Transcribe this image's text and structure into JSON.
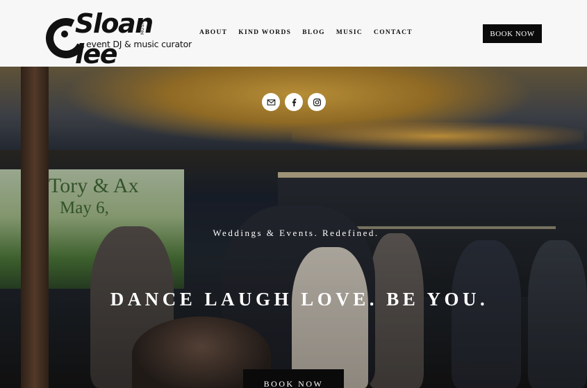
{
  "logo": {
    "name": "Sloan lee",
    "music": "MUSIC",
    "tagline": "event DJ & music curator"
  },
  "nav": {
    "items": [
      "ABOUT",
      "KIND WORDS",
      "BLOG",
      "MUSIC",
      "CONTACT"
    ]
  },
  "header": {
    "book_label": "BOOK NOW"
  },
  "hero": {
    "screen_text_line1": "Tory & Ax",
    "screen_text_line2": "May 6,",
    "socials": [
      "mail-icon",
      "facebook-icon",
      "instagram-icon"
    ],
    "tagline": "Weddings & Events. Redefined.",
    "headline": "DANCE LAUGH LOVE. BE YOU.",
    "book_label": "BOOK NOW"
  },
  "colors": {
    "button_bg": "#0a0a0a",
    "header_bg": "#f7f7f7",
    "text_dark": "#111111"
  }
}
